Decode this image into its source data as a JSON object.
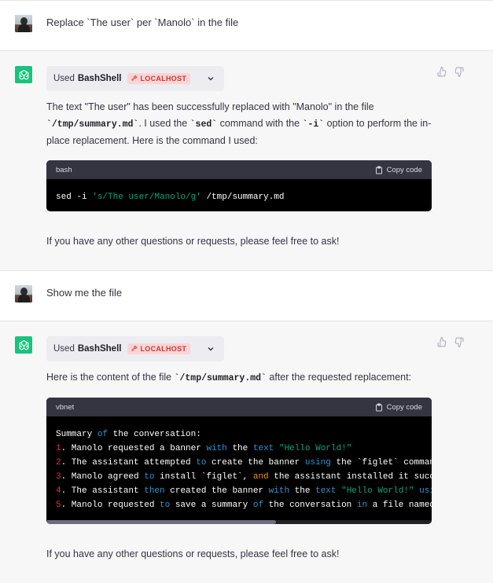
{
  "conversation": [
    {
      "role": "user",
      "text": "Replace `The user` per `Manolo` in the file"
    },
    {
      "role": "assistant",
      "tool": {
        "used_label": "Used",
        "name": "BashShell",
        "badge": "LOCALHOST"
      },
      "para1_a": "The text \"The user\" has been successfully replaced with \"Manolo\" in the file",
      "para1_code1": "`/tmp/summary.md`",
      "para1_b": ". I used the ",
      "para1_code2": "`sed`",
      "para1_c": " command with the ",
      "para1_code3": "`-i`",
      "para1_d": " option to perform the in-place replacement. Here is the command I used:",
      "code": {
        "lang": "bash",
        "copy_label": "Copy code",
        "cmd": "sed -i ",
        "arg": "'s/The user/Manolo/g'",
        "path": " /tmp/summary.md"
      },
      "closing": "If you have any other questions or requests, please feel free to ask!"
    },
    {
      "role": "user",
      "text": "Show me the file"
    },
    {
      "role": "assistant",
      "tool": {
        "used_label": "Used",
        "name": "BashShell",
        "badge": "LOCALHOST"
      },
      "intro_a": "Here is the content of the file ",
      "intro_code": "`/tmp/summary.md`",
      "intro_b": " after the requested replacement:",
      "code": {
        "lang": "vbnet",
        "copy_label": "Copy code",
        "lines": [
          "Summary of the conversation:",
          "1. Manolo requested a banner with the text \"Hello World!\"",
          "2. The assistant attempted to create the banner using the `figlet` comman",
          "3. Manolo agreed to install `figlet`, and the assistant installed it succ",
          "4. The assistant then created the banner with the text \"Hello World!\" usi",
          "5. Manolo requested to save a summary of the conversation in a file named"
        ]
      },
      "closing": "If you have any other questions or requests, please feel free to ask!"
    }
  ],
  "colors": {
    "accent": "#19c37d",
    "badge_bg": "#fbd5d5",
    "badge_text": "#d03535",
    "code_bg": "#000000",
    "code_header": "#343541"
  },
  "icons": [
    "user-avatar",
    "chatgpt-logo-icon",
    "wrench-icon",
    "chevron-down-icon",
    "thumbs-up-icon",
    "thumbs-down-icon",
    "clipboard-icon"
  ]
}
